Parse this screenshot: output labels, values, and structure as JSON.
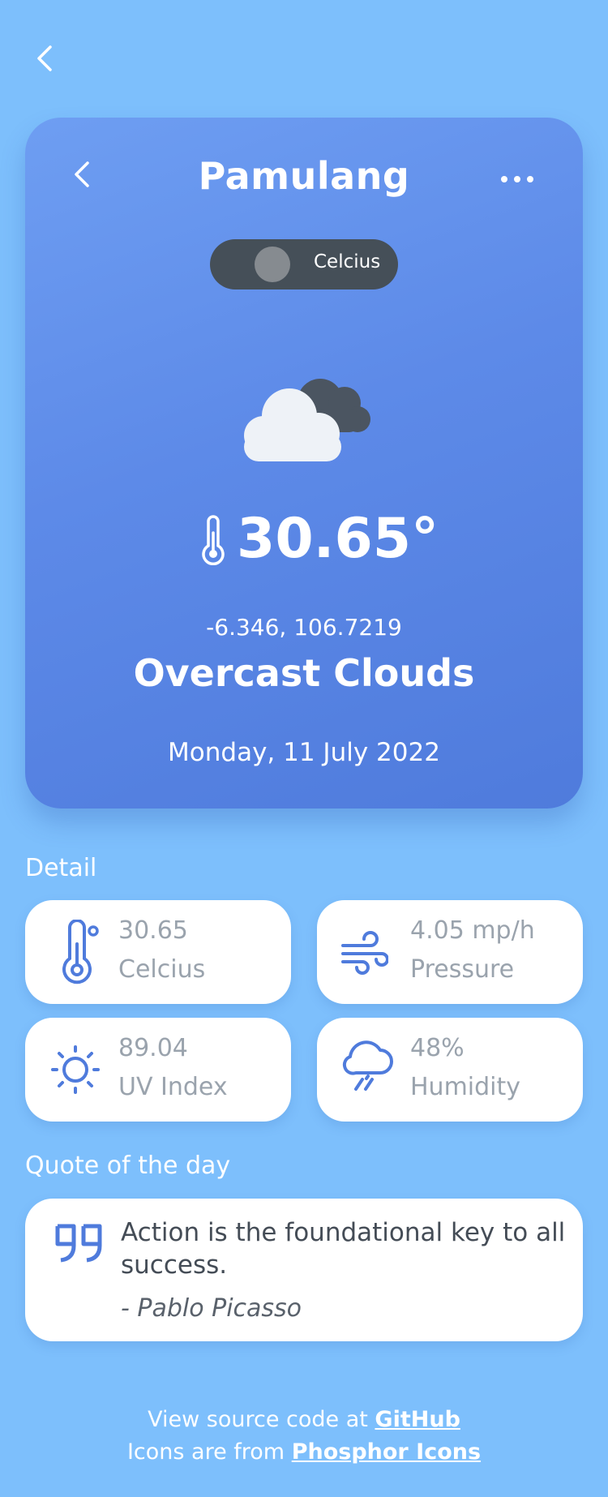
{
  "header": {
    "city": "Pamulang"
  },
  "toggle": {
    "label": "Celcius"
  },
  "current": {
    "temperature": "30.65°",
    "coordinates": "-6.346, 106.7219",
    "description": "Overcast Clouds",
    "date": "Monday, 11 July 2022"
  },
  "detail": {
    "title": "Detail",
    "tiles": [
      {
        "icon": "thermometer-icon",
        "value": "30.65",
        "label": "Celcius"
      },
      {
        "icon": "wind-icon",
        "value": "4.05 mp/h",
        "label": "Pressure"
      },
      {
        "icon": "sun-icon",
        "value": "89.04",
        "label": "UV Index"
      },
      {
        "icon": "cloud-rain-icon",
        "value": "48%",
        "label": "Humidity"
      }
    ]
  },
  "quote": {
    "title": "Quote of the day",
    "text": "Action is the foundational key to all success.",
    "author": "- Pablo Picasso"
  },
  "footer": {
    "line1_prefix": "View source code at ",
    "line1_link": "GitHub",
    "line2_prefix": "Icons are from ",
    "line2_link": "Phosphor Icons"
  },
  "colors": {
    "background": "#7dbffc",
    "card_gradient_start": "#6e9ef2",
    "card_gradient_end": "#4f7bdc",
    "icon_accent": "#4f7bdc",
    "toggle_bg": "#454f58"
  }
}
